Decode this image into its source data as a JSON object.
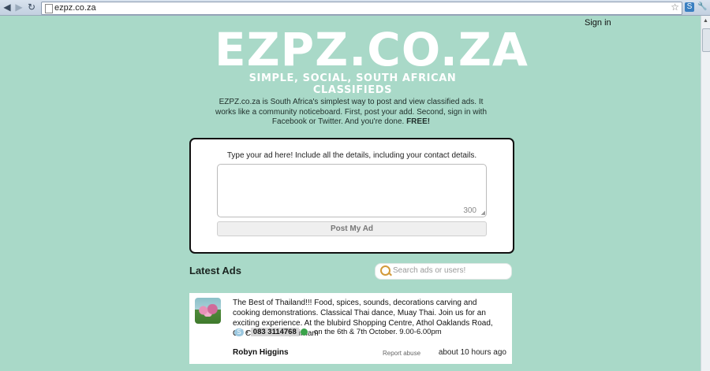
{
  "browser": {
    "url": "ezpz.co.za",
    "back_icon": "arrow-left",
    "forward_icon": "arrow-right",
    "reload_icon": "reload",
    "star_icon": "star",
    "wrench_icon": "wrench"
  },
  "header": {
    "signin": "Sign in"
  },
  "logo": {
    "title": "EZPZ.CO.ZA",
    "tagline": "SIMPLE, SOCIAL, SOUTH AFRICAN CLASSIFIEDS"
  },
  "intro": {
    "text": "EZPZ.co.za is South Africa's simplest way to post and view classified ads. It works like a community noticeboard. First, post your add. Second, sign in with Facebook or Twitter. And you're done.",
    "free": "FREE!"
  },
  "post_form": {
    "hint": "Type your ad here! Include all the details, including your contact details.",
    "char_count": "300",
    "button": "Post My Ad"
  },
  "latest": {
    "heading": "Latest Ads",
    "search_placeholder": "Search ads or users!"
  },
  "ads": [
    {
      "text": "The Best of Thailand!!! Food, spices, sounds, decorations carving and cooking demonstrations. Classical Thai dance, Muay Thai. Join us for an exciting experience. At the blubird Shopping Centre, Athol Oaklands Road, Off Corlett Drive, Birnam",
      "phone": "083 3114768",
      "dates": "on the 6th & 7th October. 9.00-6.00pm",
      "author": "Robyn Higgins",
      "report": "Report abuse",
      "time": "about 10 hours ago"
    }
  ],
  "colors": {
    "page_bg": "#a9d9c8",
    "logo": "#ffffff",
    "search_icon": "#d39a3a"
  }
}
